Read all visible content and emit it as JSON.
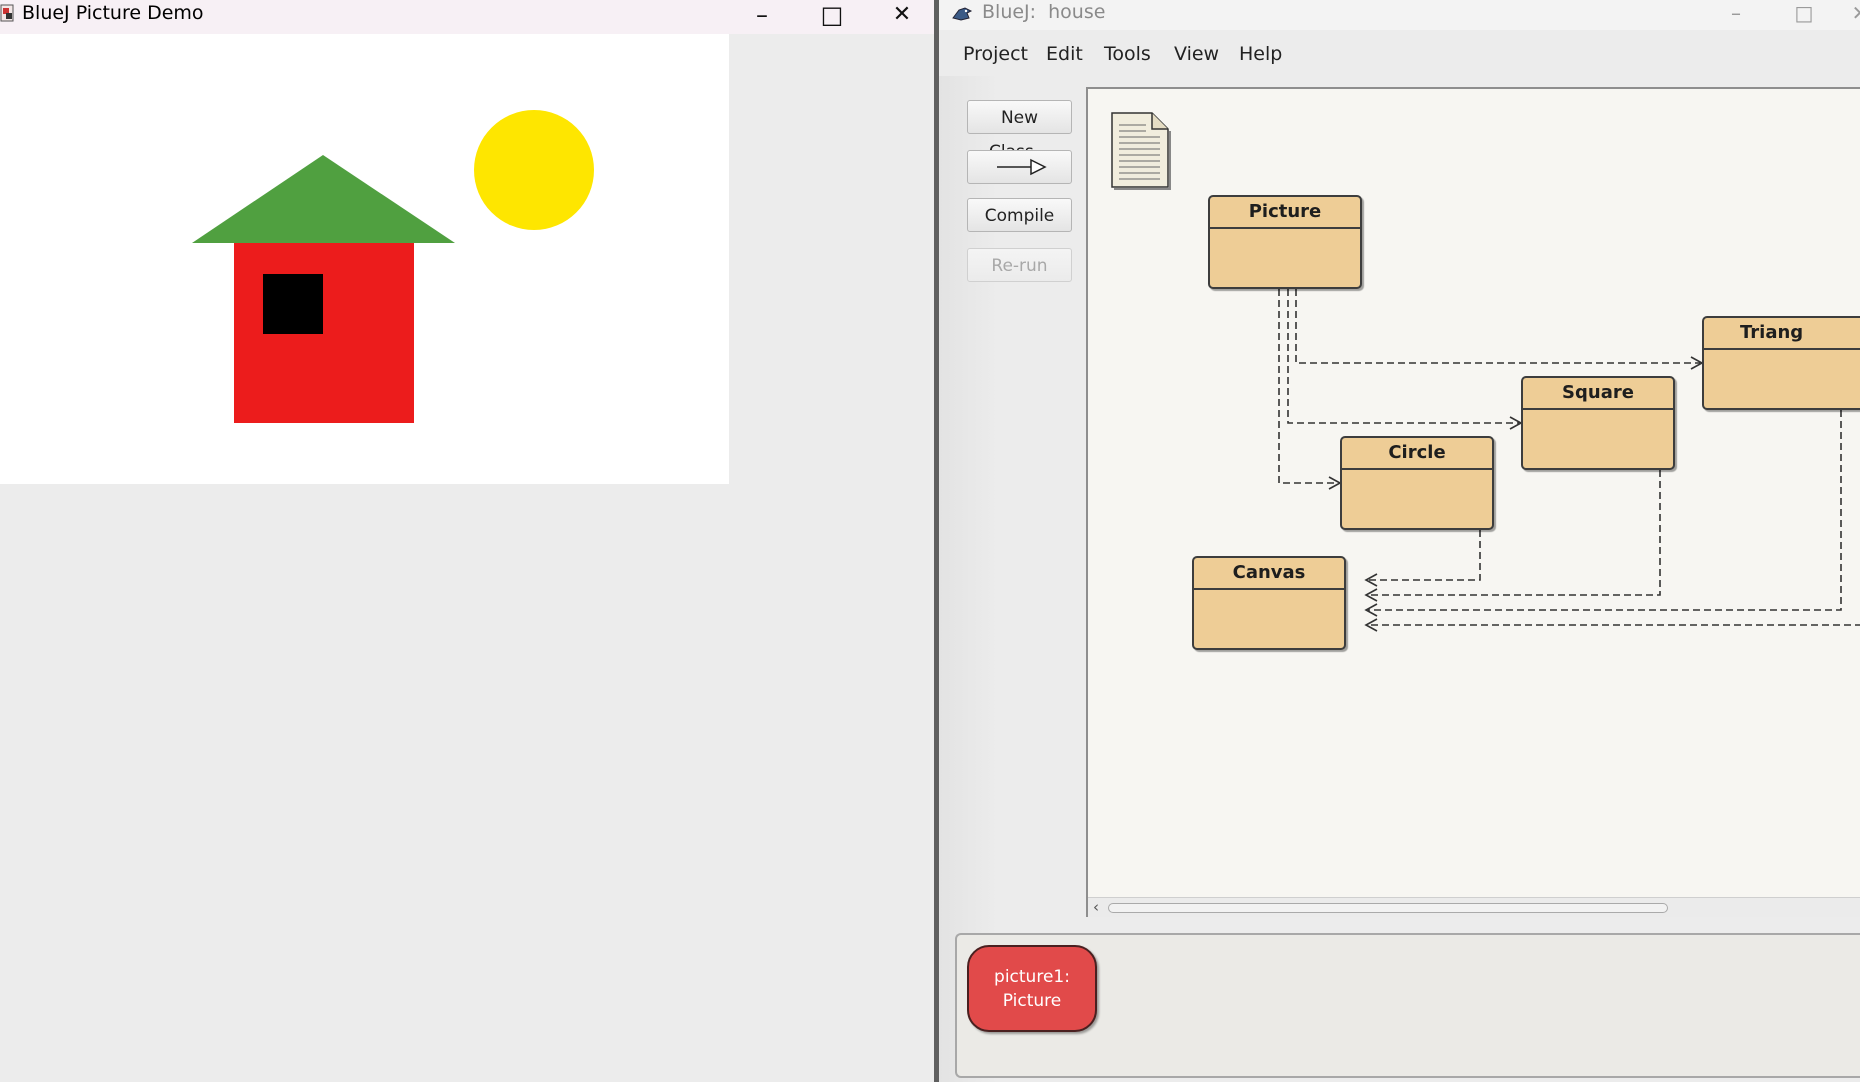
{
  "demo_window": {
    "title": "BlueJ Picture Demo",
    "controls": {
      "minimize": "–",
      "maximize": "□",
      "close": "✕"
    },
    "scene": {
      "sun_color": "#fee600",
      "roof_color": "#50a040",
      "wall_color": "#ec1c1c",
      "window_color": "#000000"
    }
  },
  "bluej_window": {
    "title": "BlueJ:  house",
    "controls": {
      "minimize": "–",
      "maximize": "□",
      "close": "✕"
    },
    "menu": [
      "Project",
      "Edit",
      "Tools",
      "View",
      "Help"
    ],
    "toolbar": {
      "new_class": "New Class...",
      "compile": "Compile",
      "rerun": "Re-run"
    },
    "diagram": {
      "classes": {
        "picture": "Picture",
        "triangle": "Triang",
        "square": "Square",
        "circle": "Circle",
        "canvas": "Canvas"
      },
      "class_color": "#eecd96"
    },
    "object_bench": {
      "object_line1": "picture1:",
      "object_line2": "Picture",
      "object_color": "#e14a4a"
    }
  }
}
